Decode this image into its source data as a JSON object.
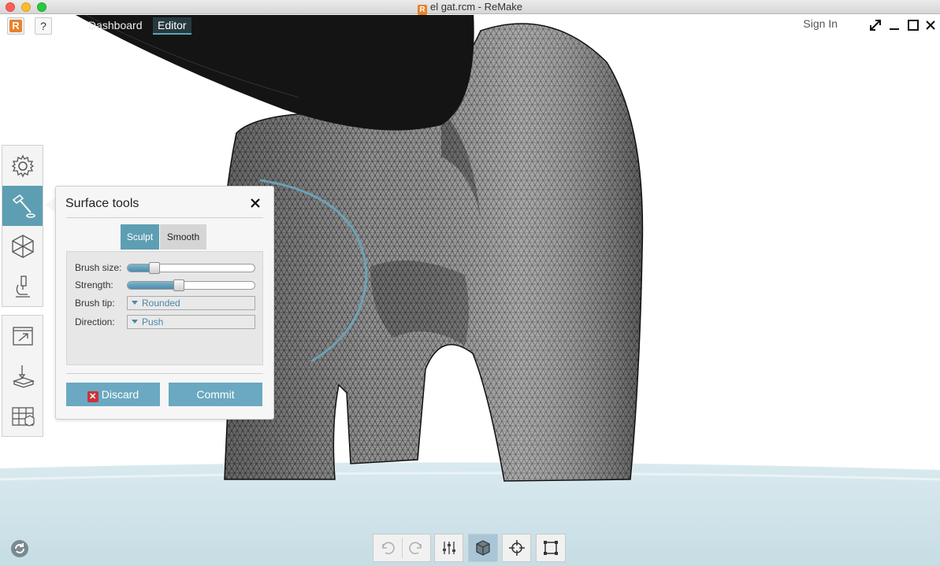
{
  "window": {
    "title": "el gat.rcm - ReMake"
  },
  "appbar": {
    "logo_letter": "R",
    "help_label": "?",
    "tabs": [
      {
        "label": "Dashboard",
        "active": false
      },
      {
        "label": "Editor",
        "active": true
      }
    ],
    "sign_in": "Sign In"
  },
  "left_toolbar": {
    "group1": [
      {
        "icon": "gear-icon"
      },
      {
        "icon": "hammer-icon",
        "active": true
      },
      {
        "icon": "hexagon-mesh-icon"
      },
      {
        "icon": "microscope-icon"
      }
    ],
    "group2": [
      {
        "icon": "export-icon"
      },
      {
        "icon": "print-3d-icon"
      },
      {
        "icon": "grid-cube-icon"
      }
    ]
  },
  "surface_tools": {
    "title": "Surface tools",
    "tabs": {
      "sculpt": "Sculpt",
      "smooth": "Smooth"
    },
    "brush_size": {
      "label": "Brush size:",
      "value": 0.22
    },
    "strength": {
      "label": "Strength:",
      "value": 0.41
    },
    "brush_tip": {
      "label": "Brush tip:",
      "value": "Rounded"
    },
    "direction": {
      "label": "Direction:",
      "value": "Push"
    },
    "discard_label": "Discard",
    "commit_label": "Commit"
  },
  "bottom_toolbar": [
    {
      "icon": "undo-icon"
    },
    {
      "icon": "redo-icon"
    },
    {
      "icon": "sliders-icon"
    },
    {
      "icon": "cube-icon",
      "active": true
    },
    {
      "icon": "crosshair-icon"
    },
    {
      "icon": "frame-icon"
    }
  ],
  "colors": {
    "accent": "#5e9eb3",
    "ground": "#cfe3e9",
    "discard_x": "#c8343a"
  }
}
